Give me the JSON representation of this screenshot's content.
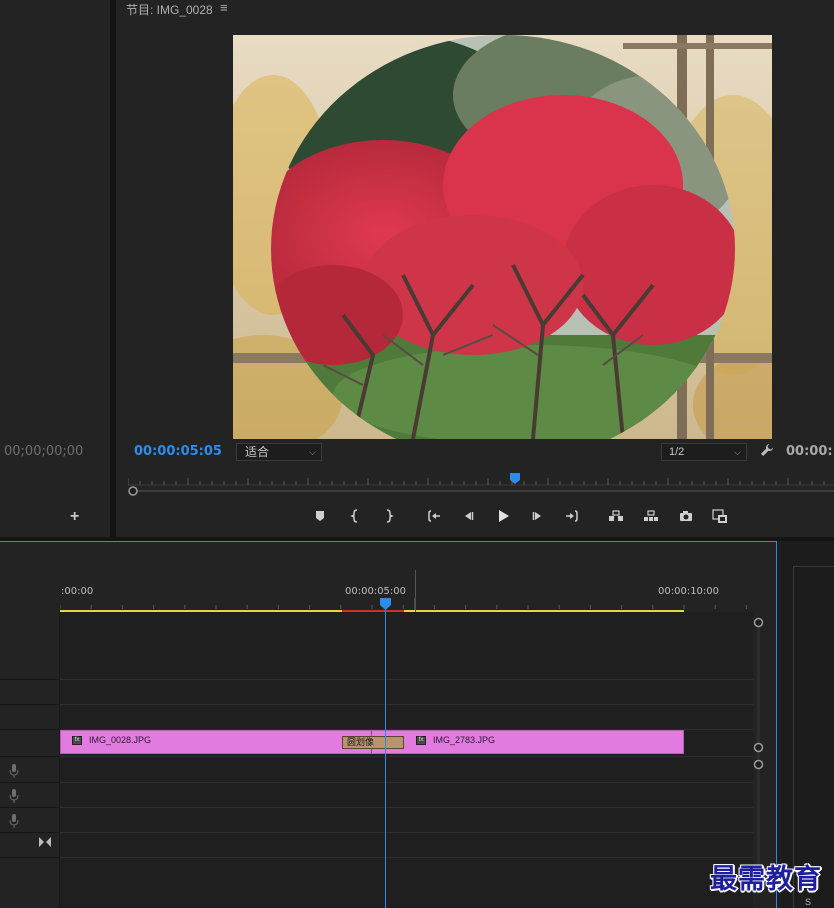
{
  "source_monitor": {
    "timecode": "00;00;00;00"
  },
  "program_monitor": {
    "title": "节目: IMG_0028",
    "menu_icon": "hamburger-icon",
    "timecode": "00:00:05:05",
    "fit_value": "适合",
    "resolution_value": "1/2",
    "duration": "00:00:1"
  },
  "transport": {
    "buttons": [
      "add-marker",
      "mark-in",
      "mark-out",
      "go-to-in",
      "step-back",
      "play",
      "step-forward",
      "go-to-out",
      "lift",
      "extract",
      "export-frame",
      "button-editor"
    ]
  },
  "timeline": {
    "ruler_labels": [
      ":00:00",
      "00:00:05:00",
      "00:00:10:00"
    ],
    "clip_a_name": "IMG_0028.JPG",
    "clip_b_name": "IMG_2783.JPG",
    "transition_name": "圆划像",
    "playhead_color": "#2d8ceb",
    "clip_color": "#e27be0"
  },
  "right_panel": {
    "label": "S"
  },
  "watermark": "最需教育"
}
